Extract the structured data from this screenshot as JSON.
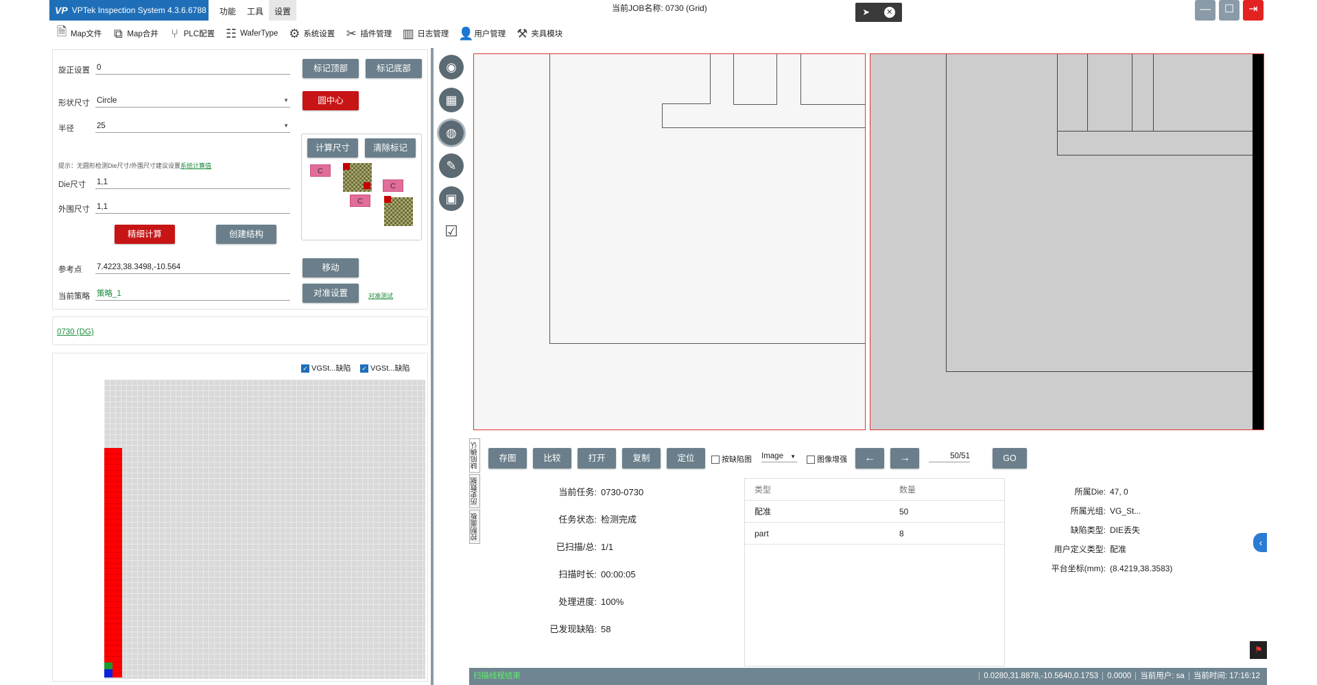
{
  "app": {
    "title": "VPTek Inspection System 4.3.6.6788",
    "logo": "VP",
    "menu": [
      "功能",
      "工具",
      "设置"
    ],
    "job_name": "当前JOB名称:  0730 (Grid)"
  },
  "toolbar": [
    "Map文件",
    "Map合并",
    "PLC配置",
    "WaferType",
    "系统设置",
    "插件管理",
    "日志管理",
    "用户管理",
    "夹具模块"
  ],
  "settings": {
    "rotation_label": "旋正设置",
    "rotation_value": "0",
    "mark_top": "标记顶部",
    "mark_bottom": "标记底部",
    "shape_label": "形状尺寸",
    "shape_value": "Circle",
    "center_btn": "圆中心",
    "radius_label": "半径",
    "radius_value": "25",
    "hint_text": "提示：无圆形检测Die尺寸/外围尺寸建议设置",
    "hint_link": "系统计算值",
    "die_label": "Die尺寸",
    "die_value": "1,1",
    "outer_label": "外围尺寸",
    "outer_value": "1,1",
    "fine_calc": "精细计算",
    "create_struct": "创建结构",
    "calc_size": "计算尺寸",
    "clear_marks": "清除标记",
    "c_label": "C",
    "ref_label": "参考点",
    "ref_value": "7.4223,38.3498,-10.564",
    "move_btn": "移动",
    "strategy_label": "当前策略",
    "strategy_value": "策略_1",
    "align_btn": "对准设置",
    "align_test": "对准测试"
  },
  "job_link": "0730 (DG)",
  "map": {
    "check1": "VGSt...缺陷",
    "check2": "VGSt...缺陷"
  },
  "vertical_tabs": [
    "缺陷确认",
    "历史数据",
    "控制面板"
  ],
  "actions": {
    "save": "存图",
    "compare": "比较",
    "open": "打开",
    "copy": "复制",
    "locate": "定位",
    "by_defect": "按缺陷图",
    "image_select": "Image",
    "enhance": "图像增强",
    "prev": "←",
    "next": "→",
    "page": "50/51",
    "go": "GO"
  },
  "task_info": [
    {
      "key": "当前任务:",
      "value": "0730-0730"
    },
    {
      "key": "任务状态:",
      "value": "检测完成"
    },
    {
      "key": "已扫描/总:",
      "value": "1/1"
    },
    {
      "key": "扫描时长:",
      "value": "00:00:05"
    },
    {
      "key": "处理进度:",
      "value": "100%"
    },
    {
      "key": "已发现缺陷:",
      "value": "58"
    }
  ],
  "defect_table": {
    "headers": [
      "类型",
      "数量"
    ],
    "rows": [
      [
        "配准",
        "50"
      ],
      [
        "part",
        "8"
      ]
    ]
  },
  "defect_info": [
    {
      "key": "所属Die:",
      "value": "47, 0"
    },
    {
      "key": "所属光组:",
      "value": "VG_St..."
    },
    {
      "key": "缺陷类型:",
      "value": "DIE丢失"
    },
    {
      "key": "用户定义类型:",
      "value": "配准"
    },
    {
      "key": "平台坐标(mm):",
      "value": "(8.4219,38.3583)"
    }
  ],
  "status": {
    "left": "扫描线程结束",
    "coords": "0.0280,31.8878,-10.5640,0.1753",
    "value": "0.0000",
    "user": "当前用户: sa",
    "time": "当前时间: 17:16:12"
  },
  "colors": {
    "accent": "#1f6fb8",
    "button": "#6a7f8b",
    "danger": "#c71414",
    "status": "#6f8591"
  }
}
